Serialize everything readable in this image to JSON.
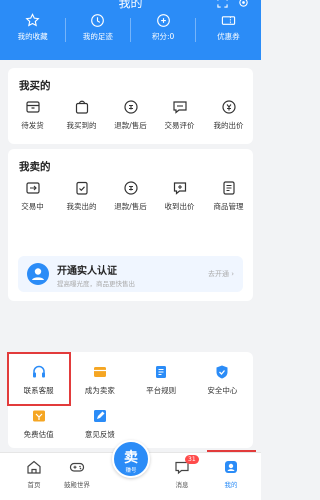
{
  "header": {
    "title": "我的",
    "quick": [
      {
        "label": "我的收藏",
        "icon": "star-icon"
      },
      {
        "label": "我的足迹",
        "icon": "footprint-icon"
      },
      {
        "label": "积分:0",
        "icon": "points-icon"
      },
      {
        "label": "优惠券",
        "icon": "coupon-icon"
      }
    ]
  },
  "buy": {
    "title": "我买的",
    "items": [
      {
        "label": "待发货",
        "icon": "box-icon"
      },
      {
        "label": "我买到的",
        "icon": "bag-icon"
      },
      {
        "label": "退款/售后",
        "icon": "refund-icon"
      },
      {
        "label": "交易评价",
        "icon": "comment-icon"
      },
      {
        "label": "我的出价",
        "icon": "bid-icon"
      }
    ]
  },
  "sell": {
    "title": "我卖的",
    "items": [
      {
        "label": "交易中",
        "icon": "trade-icon"
      },
      {
        "label": "我卖出的",
        "icon": "sold-icon"
      },
      {
        "label": "退款/售后",
        "icon": "refund-icon"
      },
      {
        "label": "收到出价",
        "icon": "received-bid-icon"
      },
      {
        "label": "商品管理",
        "icon": "goods-manage-icon"
      }
    ],
    "auth": {
      "title": "开通实人认证",
      "subtitle": "提高曝光度，商品更快售出",
      "action": "去开通"
    }
  },
  "services": [
    {
      "label": "联系客服",
      "icon": "headset-icon"
    },
    {
      "label": "成为卖家",
      "icon": "seller-icon"
    },
    {
      "label": "平台规则",
      "icon": "rules-icon"
    },
    {
      "label": "安全中心",
      "icon": "shield-icon"
    },
    {
      "label": "免费估值",
      "icon": "valuation-icon"
    },
    {
      "label": "意见反馈",
      "icon": "feedback-icon"
    }
  ],
  "tabbar": {
    "items": [
      {
        "label": "首页",
        "icon": "home-icon"
      },
      {
        "label": "鼓殿世界",
        "icon": "gamepad-icon"
      },
      {
        "label": "消息",
        "icon": "message-icon",
        "badge": "31"
      },
      {
        "label": "我的",
        "icon": "profile-icon"
      }
    ],
    "sell_main": "卖",
    "sell_sub": "赚号"
  },
  "colors": {
    "primary": "#2b8cf7",
    "highlight": "#e23b3b",
    "accent_orange": "#f5a623"
  }
}
